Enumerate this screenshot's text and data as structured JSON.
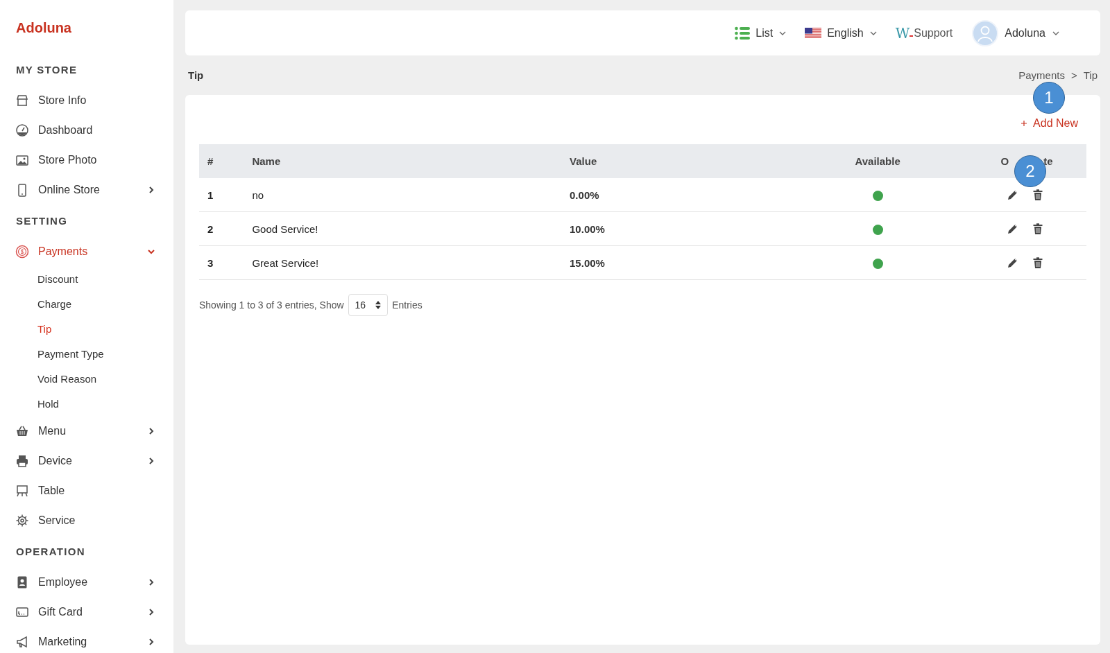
{
  "sidebar": {
    "logo": "Adoluna",
    "sections": [
      {
        "heading": "MY STORE",
        "items": [
          {
            "label": "Store Info",
            "selected": false
          },
          {
            "label": "Dashboard",
            "selected": false
          },
          {
            "label": "Store Photo",
            "selected": false
          },
          {
            "label": "Online Store",
            "selected": false,
            "expanded": false
          }
        ]
      },
      {
        "heading": "SETTING",
        "items": [
          {
            "label": "Payments",
            "selected": true,
            "expanded": true,
            "children": [
              {
                "label": "Discount",
                "selected": false
              },
              {
                "label": "Charge",
                "selected": false
              },
              {
                "label": "Tip",
                "selected": true
              },
              {
                "label": "Payment Type",
                "selected": false
              },
              {
                "label": "Void Reason",
                "selected": false
              },
              {
                "label": "Hold",
                "selected": false
              }
            ]
          },
          {
            "label": "Menu",
            "selected": false,
            "expanded": false
          },
          {
            "label": "Device",
            "selected": false,
            "expanded": false
          },
          {
            "label": "Table",
            "selected": false
          },
          {
            "label": "Service",
            "selected": false
          }
        ]
      },
      {
        "heading": "OPERATION",
        "items": [
          {
            "label": "Employee",
            "selected": false,
            "expanded": false
          },
          {
            "label": "Gift Card",
            "selected": false,
            "expanded": false
          },
          {
            "label": "Marketing",
            "selected": false,
            "expanded": false
          }
        ]
      }
    ]
  },
  "topbar": {
    "view": "List",
    "language": "English",
    "support": {
      "logo_letter": "W",
      "label": "Support"
    },
    "user": "Adoluna"
  },
  "page_title": "Tip",
  "breadcrumb": {
    "items": [
      "Payments",
      "Tip"
    ],
    "separator": ">"
  },
  "add_button": "Add New",
  "table": {
    "columns": [
      {
        "label": "#"
      },
      {
        "label": "Name"
      },
      {
        "label": "Value"
      },
      {
        "label": "Available"
      },
      {
        "visible_parts": [
          "O",
          "te"
        ]
      }
    ],
    "rows": [
      {
        "index": "1",
        "name": "no",
        "value": "0.00%",
        "available": true
      },
      {
        "index": "2",
        "name": "Good Service!",
        "value": "10.00%",
        "available": true
      },
      {
        "index": "3",
        "name": "Great Service!",
        "value": "15.00%",
        "available": true
      }
    ]
  },
  "footer": {
    "summary": "Showing 1 to 3 of 3 entries, Show",
    "page_size": "16",
    "suffix": "Entries"
  },
  "callouts": [
    {
      "label": "1"
    },
    {
      "label": "2"
    }
  ]
}
